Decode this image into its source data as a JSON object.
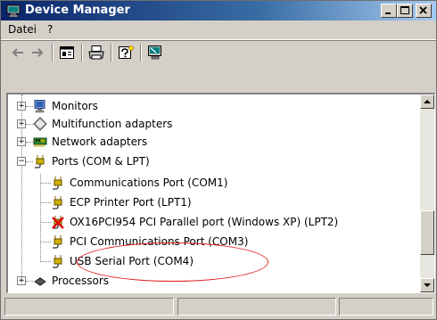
{
  "window": {
    "title": "Device Manager"
  },
  "menubar": {
    "items": [
      {
        "label": "Datei"
      },
      {
        "label": "?"
      }
    ]
  },
  "toolbar": {
    "icons": [
      "back-arrow-icon",
      "forward-arrow-icon",
      "properties-icon",
      "print-icon",
      "help-icon",
      "scan-hardware-icon"
    ]
  },
  "tree": {
    "items": [
      {
        "label": "Monitors",
        "icon": "monitor-icon",
        "expanded": false
      },
      {
        "label": "Multifunction adapters",
        "icon": "multifunction-adapter-icon",
        "expanded": false
      },
      {
        "label": "Network adapters",
        "icon": "network-adapter-icon",
        "expanded": false
      },
      {
        "label": "Ports (COM & LPT)",
        "icon": "port-connector-icon",
        "expanded": true
      },
      {
        "label": "Communications Port (COM1)",
        "icon": "port-connector-icon"
      },
      {
        "label": "ECP Printer Port (LPT1)",
        "icon": "port-connector-icon"
      },
      {
        "label": "OX16PCI954 PCI Parallel port (Windows XP) (LPT2)",
        "icon": "disabled-device-icon",
        "status": "disabled"
      },
      {
        "label": "PCI Communications Port (COM3)",
        "icon": "port-connector-icon"
      },
      {
        "label": "USB Serial Port (COM4)",
        "icon": "port-connector-icon",
        "highlighted": true
      },
      {
        "label": "Processors",
        "icon": "processor-icon",
        "expanded": false
      }
    ]
  },
  "colors": {
    "titlebar_start": "#0a246a",
    "titlebar_end": "#a6caf0",
    "annotation": "#e02020",
    "chrome": "#d4d0c8"
  }
}
